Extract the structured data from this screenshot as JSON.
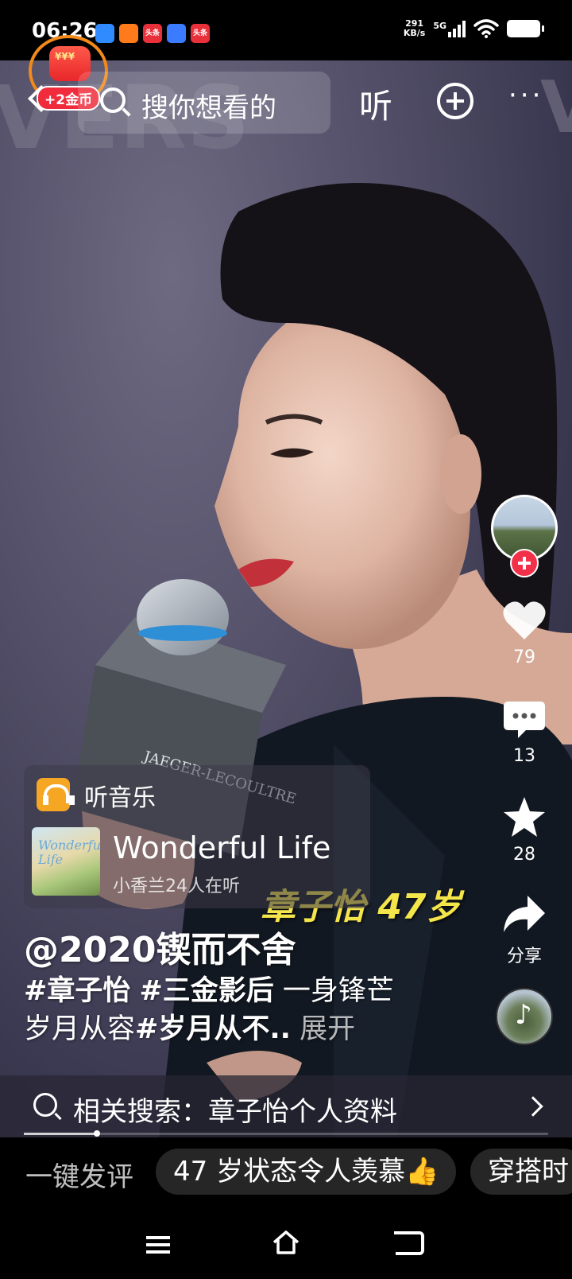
{
  "status_bar": {
    "time": "06:26",
    "net_speed_value": "291",
    "net_speed_unit": "KB/s",
    "network_type": "5G",
    "notification_icons": [
      {
        "name": "app-icon-1",
        "color": "#2f8bff",
        "label": ""
      },
      {
        "name": "app-icon-2",
        "color": "#ff7a1a",
        "label": ""
      },
      {
        "name": "toutiao-icon",
        "color": "#e8303a",
        "label": "头条"
      },
      {
        "name": "app-icon-4",
        "color": "#3a7bff",
        "label": ""
      },
      {
        "name": "toutiao-icon-2",
        "color": "#e8303a",
        "label": "头条"
      }
    ]
  },
  "top_bar": {
    "coin_reward": "+2金币",
    "search_placeholder": "搜你想看的",
    "listen_label": "听",
    "more_label": "···"
  },
  "rail": {
    "likes": "79",
    "comments": "13",
    "favorites": "28",
    "share_label": "分享"
  },
  "music_card": {
    "title": "听音乐",
    "album_text": "Wonderful Life",
    "song_name": "Wonderful Life",
    "listeners": "小香兰24人在听"
  },
  "video": {
    "subtitle": "章子怡 47岁"
  },
  "caption": {
    "author": "@2020锲而不舍",
    "tag1": "#章子怡",
    "tag2": "#三金影后",
    "text1": " 一身锋芒",
    "text2": "岁月从容",
    "tag3": "#岁月从不..",
    "expand": " 展开"
  },
  "related_search": {
    "text": "相关搜索：章子怡个人资料"
  },
  "playback": {
    "progress": 0.14
  },
  "comment_chips": {
    "quick_comment": "一键发评",
    "chip1": "47 岁状态令人羡慕👍",
    "chip2": "穿搭时"
  },
  "colors": {
    "accent_red": "#f2304a",
    "coin_orange": "#f28a1a",
    "subtitle_yellow": "#f4e54a",
    "music_orange": "#f5a623"
  }
}
